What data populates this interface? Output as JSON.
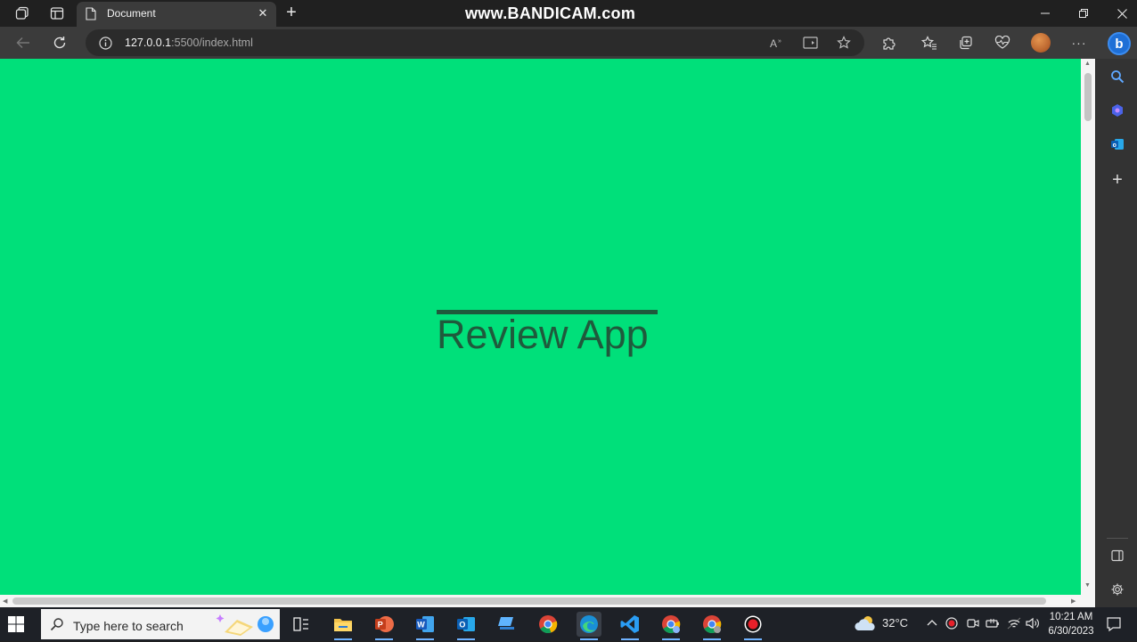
{
  "browser": {
    "tab_title": "Document",
    "tab_close_glyph": "✕",
    "new_tab_glyph": "+",
    "url_host": "127.0.0.1",
    "url_path": ":5500/index.html",
    "more_glyph": "···",
    "copilot_letter": "b"
  },
  "recording": {
    "watermark": "www.BANDICAM.com"
  },
  "page": {
    "background": "#00e07a",
    "heading": "Review App",
    "heading_color": "#1f5a3c"
  },
  "sidebar": {
    "add_glyph": "+"
  },
  "taskbar": {
    "search_placeholder": "Type here to search",
    "weather_temp": "32°C",
    "time": "10:21 AM",
    "date": "6/30/2023",
    "apps": [
      "task-view",
      "file-explorer",
      "powerpoint",
      "word",
      "outlook",
      "terminal",
      "chrome",
      "edge",
      "vscode",
      "chrome-profile-1",
      "chrome-profile-2",
      "bandicam"
    ]
  },
  "icons": {
    "tab_actions": "tab-actions-icon",
    "vertical_tabs": "vertical-tabs-icon",
    "page": "page-icon",
    "back": "arrow-left-icon",
    "reload": "reload-icon",
    "info": "info-icon",
    "read_aloud": "read-aloud-icon",
    "immersive_reader": "immersive-reader-icon",
    "favorite": "star-icon",
    "extensions": "puzzle-icon",
    "favorites": "favorites-icon",
    "collections": "collections-icon",
    "performance": "heart-pulse-icon",
    "settings": "gear-icon"
  }
}
